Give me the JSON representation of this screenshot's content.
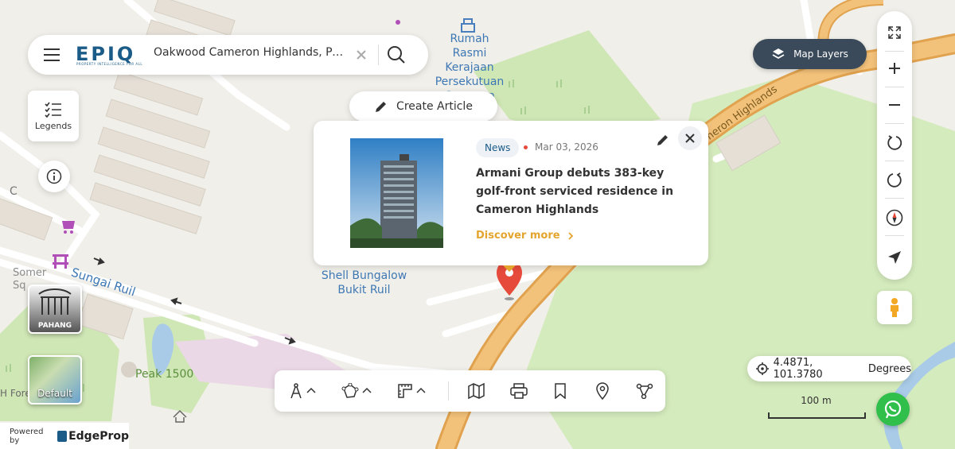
{
  "search": {
    "logo_text": "EPIQ",
    "logo_tagline": "PROPERTY INTELLIGENCE FOR ALL",
    "query": "Oakwood Cameron Highlands, Pers...",
    "clear_icon": "close-icon",
    "search_icon": "search-icon"
  },
  "legends": {
    "label": "Legends"
  },
  "create_article": {
    "label": "Create Article"
  },
  "map_layers": {
    "label": "Map Layers"
  },
  "article_popup": {
    "tag": "News",
    "date": "Mar 03, 2026",
    "headline": "Armani Group debuts 383-key golf-front serviced residence in Cameron Highlands",
    "link": "Discover more",
    "image_alt": "High-rise serviced residence tower"
  },
  "coordinates": {
    "value": "4.4871, 101.3780",
    "unit": "Degrees"
  },
  "scale": {
    "label": "100 m"
  },
  "layer_thumbs": {
    "top_label": "PAHANG",
    "bottom_label": "Default"
  },
  "footer": {
    "powered_by": "Powered by",
    "brand": "EdgeProp"
  },
  "map_labels": {
    "rumah": "Rumah\nRasmi\nKerajaan\nPersekutuan\nCameron",
    "shell": "Shell Bungalow\nBukit Ruil",
    "sungai": "Sungai Ruil",
    "peak": "Peak 1500",
    "cameron": "Cameron Highlands",
    "somer": "Somer\nSq",
    "c": "C",
    "forest": "H Fore"
  },
  "colors": {
    "accent": "#e3a52d",
    "road": "#f3c27a",
    "road_edge": "#e0a24e",
    "park": "#cfe6b5",
    "water": "#a9cbe8",
    "marker": "#e64a3b",
    "brand": "#1a5b88",
    "dark_button": "#3b4a5a"
  }
}
